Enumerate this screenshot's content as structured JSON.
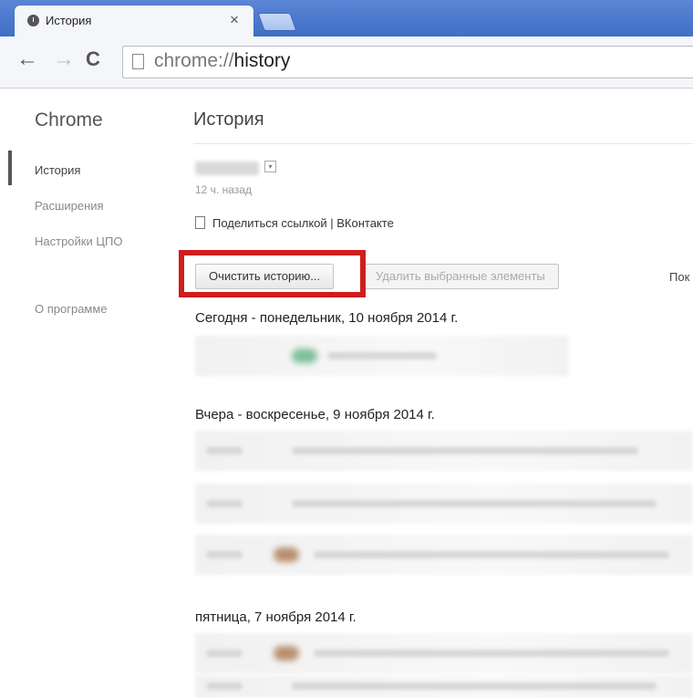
{
  "browser": {
    "tab_title": "История",
    "tab_close": "×",
    "url_prefix": "chrome://",
    "url_path": "history"
  },
  "sidebar": {
    "title": "Chrome",
    "items": [
      {
        "label": "История"
      },
      {
        "label": "Расширения"
      },
      {
        "label": "Настройки ЦПО"
      },
      {
        "label": "О программе"
      }
    ]
  },
  "main": {
    "title": "История",
    "account_time": "12 ч. назад",
    "share_label": "Поделиться ссылкой",
    "share_separator": " | ",
    "share_vk": "ВКонтакте",
    "clear_button": "Очистить историю...",
    "delete_button": "Удалить выбранные элементы",
    "overflow_text": "Пок",
    "days": [
      {
        "label": "Сегодня - понедельник, 10 ноября 2014 г."
      },
      {
        "label": "Вчера - воскресенье, 9 ноября 2014 г."
      },
      {
        "label": "пятница, 7 ноября 2014 г."
      }
    ]
  },
  "colors": {
    "highlight": "#d01d1d",
    "tabstrip": "#4a79cf"
  }
}
